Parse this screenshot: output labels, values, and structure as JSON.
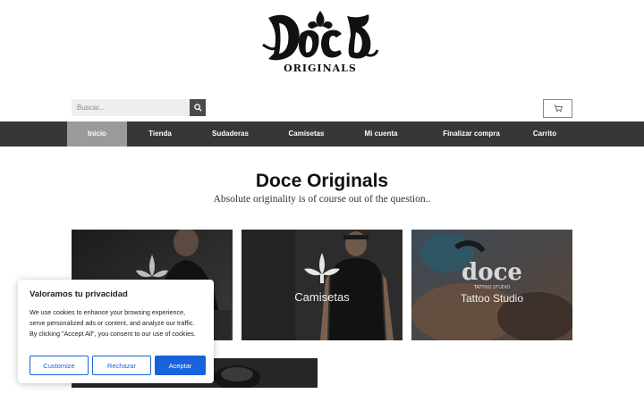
{
  "logo": {
    "text": "Doce",
    "subtext": "ORIGINALS"
  },
  "search": {
    "placeholder": "Buscar...",
    "icon": "search-icon"
  },
  "cart": {
    "icon": "cart-icon"
  },
  "nav": {
    "items": [
      {
        "label": "Inicio",
        "active": true
      },
      {
        "label": "Tienda"
      },
      {
        "label": "Sudaderas"
      },
      {
        "label": "Camisetas"
      },
      {
        "label": "Mi cuenta"
      },
      {
        "label": "Finalizar compra"
      },
      {
        "label": "Carrito"
      }
    ]
  },
  "hero": {
    "title": "Doce Originals",
    "tagline": "Absolute originality is of course out of the question.."
  },
  "categories": [
    {
      "label": ""
    },
    {
      "label": "Camisetas"
    },
    {
      "label": "Tattoo Studio"
    }
  ],
  "cookie": {
    "title": "Valoramos tu privacidad",
    "text": "We use cookies to enhance your browsing experience, serve personalized ads or content, and analyze our traffic. By clicking \"Accept All\", you consent to our use of cookies.",
    "customize": "Customize",
    "reject": "Rechazar",
    "accept": "Aceptar"
  },
  "colors": {
    "nav_bg": "#373737",
    "nav_active": "#9a9a9a",
    "accent": "#1863dc"
  }
}
